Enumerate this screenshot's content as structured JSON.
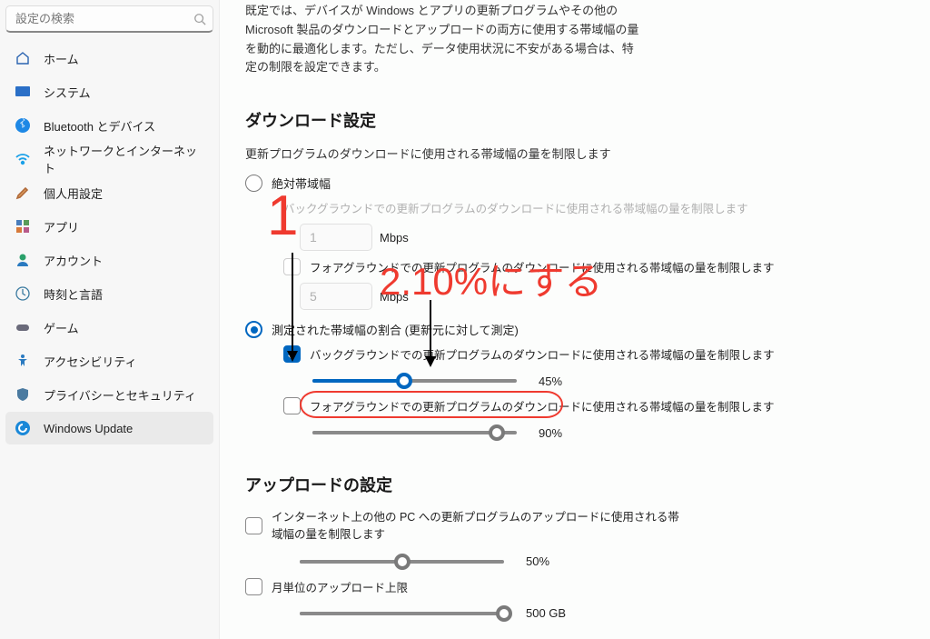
{
  "search": {
    "placeholder": "設定の検索"
  },
  "sidebar": {
    "items": [
      {
        "label": "ホーム"
      },
      {
        "label": "システム"
      },
      {
        "label": "Bluetooth とデバイス"
      },
      {
        "label": "ネットワークとインターネット"
      },
      {
        "label": "個人用設定"
      },
      {
        "label": "アプリ"
      },
      {
        "label": "アカウント"
      },
      {
        "label": "時刻と言語"
      },
      {
        "label": "ゲーム"
      },
      {
        "label": "アクセシビリティ"
      },
      {
        "label": "プライバシーとセキュリティ"
      },
      {
        "label": "Windows Update"
      }
    ],
    "selected_index": 11
  },
  "main": {
    "intro": "既定では、デバイスが Windows とアプリの更新プログラムやその他の Microsoft 製品のダウンロードとアップロードの両方に使用する帯域幅の量を動的に最適化します。ただし、データ使用状況に不安がある場合は、特定の制限を設定できます。",
    "download": {
      "heading": "ダウンロード設定",
      "sub": "更新プログラムのダウンロードに使用される帯域幅の量を制限します",
      "radio_absolute": "絶対帯域幅",
      "bg_absolute_label": "バックグラウンドでの更新プログラムのダウンロードに使用される帯域幅の量を制限します",
      "bg_absolute_value": "1",
      "fg_absolute_label": "フォアグラウンドでの更新プログラムのダウンロードに使用される帯域幅の量を制限します",
      "fg_absolute_value": "5",
      "mbps": "Mbps",
      "radio_percent": "測定された帯域幅の割合 (更新元に対して測定)",
      "bg_percent_label": "バックグラウンドでの更新プログラムのダウンロードに使用される帯域幅の量を制限します",
      "bg_percent_value": "45%",
      "bg_percent_fill": 45,
      "fg_percent_label": "フォアグラウンドでの更新プログラムのダウンロードに使用される帯域幅の量を制限します",
      "fg_percent_value": "90%",
      "fg_percent_fill": 90
    },
    "upload": {
      "heading": "アップロードの設定",
      "limit_label": "インターネット上の他の PC への更新プログラムのアップロードに使用される帯域幅の量を制限します",
      "limit_value": "50%",
      "limit_fill": 50,
      "monthly_label": "月単位のアップロード上限",
      "monthly_value": "500 GB",
      "monthly_fill": 100
    }
  },
  "annotations": {
    "num1": "1",
    "text2": "2.10%にする"
  },
  "colors": {
    "accent": "#0067c0",
    "anno": "#ef3a2f"
  }
}
